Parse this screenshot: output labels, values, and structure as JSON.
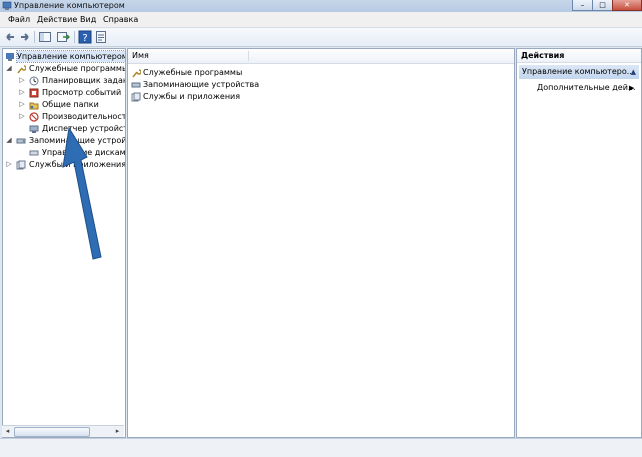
{
  "window": {
    "title": "Управление компьютером"
  },
  "menu": [
    "Файл",
    "Действие",
    "Вид",
    "Справка"
  ],
  "tree": {
    "root": "Управление компьютером (л",
    "items": [
      {
        "label": "Служебные программы",
        "icon": "tools-icon"
      },
      {
        "label": "Планировщик заданий",
        "icon": "clock-icon"
      },
      {
        "label": "Просмотр событий",
        "icon": "event-viewer-icon"
      },
      {
        "label": "Общие папки",
        "icon": "shared-folder-icon"
      },
      {
        "label": "Производительность",
        "icon": "performance-icon"
      },
      {
        "label": "Диспетчер устройств",
        "icon": "device-manager-icon"
      },
      {
        "label": "Запоминающие устройст",
        "icon": "storage-icon"
      },
      {
        "label": "Управление дисками",
        "icon": "disk-icon"
      },
      {
        "label": "Службы и приложения",
        "icon": "services-icon"
      }
    ]
  },
  "list": {
    "column": "Имя",
    "items": [
      "Служебные программы",
      "Запоминающие устройства",
      "Службы и приложения"
    ]
  },
  "actions": {
    "title": "Действия",
    "section": "Управление компьютеро...",
    "item": "Дополнительные дей..."
  },
  "colors": {
    "arrow": "#2e6db4",
    "accent": "#c3d6ee"
  }
}
